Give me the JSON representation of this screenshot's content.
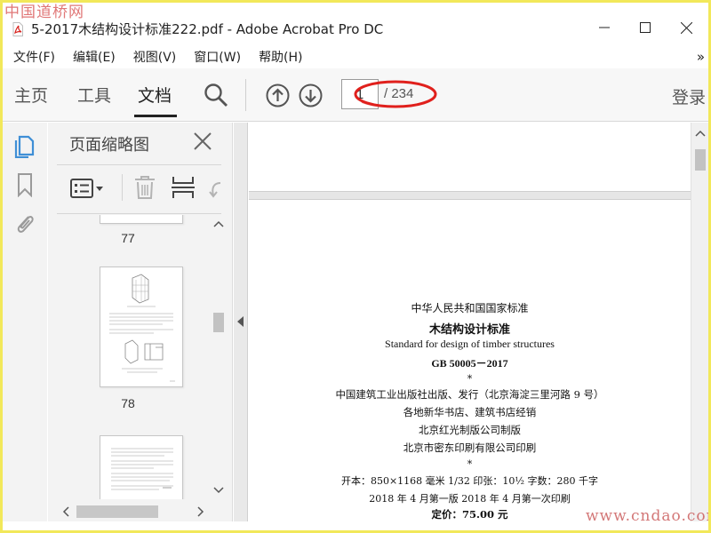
{
  "watermark": {
    "top": "中国道桥网",
    "bottom": "www.cndao.com"
  },
  "window": {
    "title": "5-2017木结构设计标准222.pdf - Adobe Acrobat Pro DC"
  },
  "menu": [
    "文件(F)",
    "编辑(E)",
    "视图(V)",
    "窗口(W)",
    "帮助(H)"
  ],
  "menu_more": "»",
  "toolbar": {
    "tabs": [
      "主页",
      "工具",
      "文档"
    ],
    "active_tab": "文档",
    "page_current": "1",
    "page_total": "/ 234",
    "login": "登录"
  },
  "thumbnails": {
    "title": "页面缩略图",
    "pages": [
      "77",
      "78"
    ]
  },
  "document": {
    "lines": [
      "中华人民共和国国家标准",
      "木结构设计标准",
      "Standard for design of timber structures",
      "GB 50005－2017",
      "*",
      "中国建筑工业出版社出版、发行（北京海淀三里河路 9 号）",
      "各地新华书店、建筑书店经销",
      "北京红光制版公司制版",
      "北京市密东印刷有限公司印刷",
      "*",
      "开本：850×1168 毫米  1/32  印张：10½  字数：280 千字",
      "2018 年 4 月第一版    2018 年 4 月第一次印刷",
      "定价：75.00 元"
    ]
  },
  "colors": {
    "frame": "#f2e85a",
    "accent_blue": "#3f8fd6",
    "highlight_red": "#e0201c"
  },
  "icons": {
    "pdf": "pdf-file-icon",
    "search": "search-icon",
    "prev": "arrow-up-circle-icon",
    "next": "arrow-down-circle-icon",
    "pages": "page-thumbnails-icon",
    "bookmark": "bookmark-icon",
    "attachment": "paperclip-icon"
  }
}
